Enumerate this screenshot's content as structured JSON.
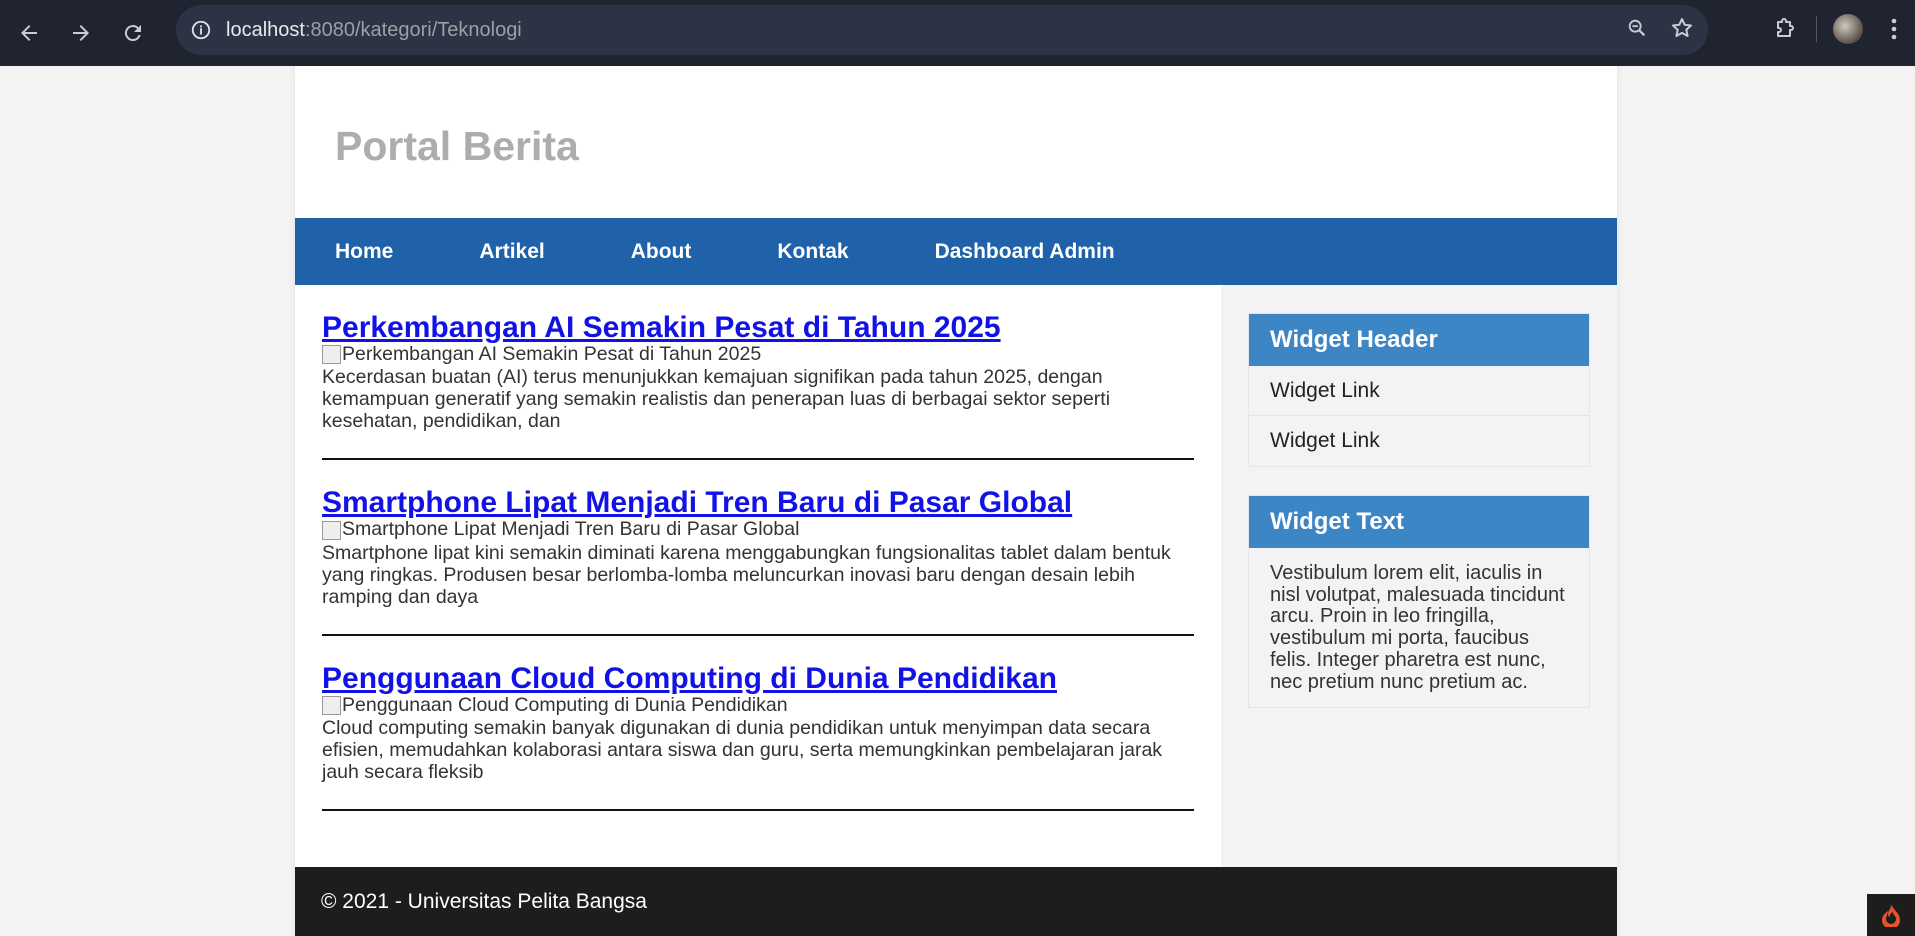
{
  "browser": {
    "url_host": "localhost",
    "url_rest": ":8080/kategori/Teknologi"
  },
  "site": {
    "title": "Portal Berita",
    "menu": [
      "Home",
      "Artikel",
      "About",
      "Kontak",
      "Dashboard Admin"
    ]
  },
  "articles": [
    {
      "title": "Perkembangan AI Semakin Pesat di Tahun 2025",
      "img_alt": "Perkembangan AI Semakin Pesat di Tahun 2025",
      "excerpt": "Kecerdasan buatan (AI) terus menunjukkan kemajuan signifikan pada tahun 2025, dengan kemampuan generatif yang semakin realistis dan penerapan luas di berbagai sektor seperti kesehatan, pendidikan, dan"
    },
    {
      "title": "Smartphone Lipat Menjadi Tren Baru di Pasar Global",
      "img_alt": "Smartphone Lipat Menjadi Tren Baru di Pasar Global",
      "excerpt": "Smartphone lipat kini semakin diminati karena menggabungkan fungsionalitas tablet dalam bentuk yang ringkas. Produsen besar berlomba-lomba meluncurkan inovasi baru dengan desain lebih ramping dan daya"
    },
    {
      "title": "Penggunaan Cloud Computing di Dunia Pendidikan",
      "img_alt": "Penggunaan Cloud Computing di Dunia Pendidikan",
      "excerpt": "Cloud computing semakin banyak digunakan di dunia pendidikan untuk menyimpan data secara efisien, memudahkan kolaborasi antara siswa dan guru, serta memungkinkan pembelajaran jarak jauh secara fleksib"
    }
  ],
  "sidebar": {
    "widget1": {
      "header": "Widget Header",
      "links": [
        "Widget Link",
        "Widget Link"
      ]
    },
    "widget2": {
      "header": "Widget Text",
      "text": "Vestibulum lorem elit, iaculis in nisl volutpat, malesuada tincidunt arcu. Proin in leo fringilla, vestibulum mi porta, faucibus felis. Integer pharetra est nunc, nec pretium nunc pretium ac."
    }
  },
  "footer": {
    "text": "© 2021 - Universitas Pelita Bangsa"
  },
  "colors": {
    "menu_bg": "#1f62a9",
    "widget_header_bg": "#3c86c6",
    "footer_bg": "#1d1d1d",
    "link": "#1212e6"
  },
  "icons": [
    "back-arrow-icon",
    "forward-arrow-icon",
    "reload-icon",
    "site-info-icon",
    "zoom-icon",
    "bookmark-star-icon",
    "extensions-icon",
    "profile-avatar",
    "more-menu-icon",
    "codeigniter-flame-icon"
  ]
}
